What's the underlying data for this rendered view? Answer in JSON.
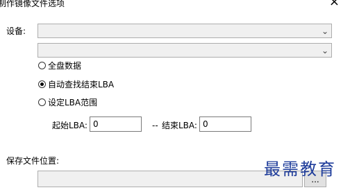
{
  "window": {
    "title": "制作镜像文件选项",
    "close_glyph": "×"
  },
  "device": {
    "label": "设备:",
    "value": "",
    "chevron_glyph": "⌄"
  },
  "partition": {
    "value": "",
    "chevron_glyph": "⌄"
  },
  "options": [
    {
      "label": "全盘数据",
      "checked": false
    },
    {
      "label": "自动查找结束LBA",
      "checked": true
    },
    {
      "label": "设定LBA范围",
      "checked": false
    }
  ],
  "range": {
    "start_label": "起始LBA:",
    "start_value": "0",
    "separator": "--",
    "end_label": "结束LBA:",
    "end_value": "0"
  },
  "save": {
    "label": "保存文件位置:",
    "path_value": "",
    "browse_label": "..."
  },
  "watermark": {
    "text": "最需教育"
  }
}
